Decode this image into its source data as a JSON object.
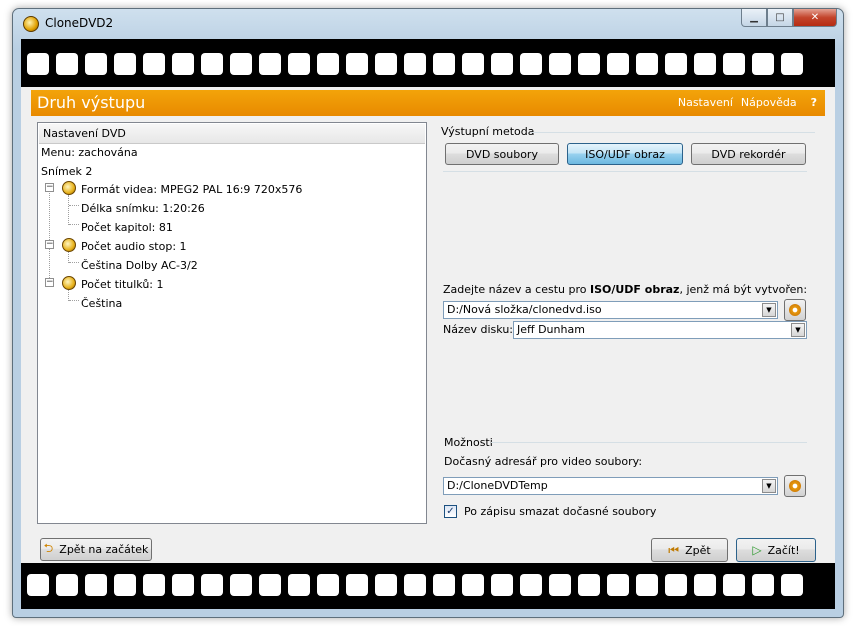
{
  "window": {
    "title": "CloneDVD2"
  },
  "header": {
    "title": "Druh výstupu",
    "links": {
      "settings": "Nastavení",
      "help": "Nápověda",
      "question": "?"
    }
  },
  "tree": {
    "header": "Nastavení DVD",
    "menu": "Menu: zachována",
    "title": "Snímek 2",
    "video": {
      "label": "Formát videa: MPEG2 PAL 16:9 720x576",
      "length": "Délka snímku: 1:20:26",
      "chapters": "Počet kapitol: 81"
    },
    "audio": {
      "label": "Počet audio stop: 1",
      "track1": "Čeština Dolby AC-3/2"
    },
    "subtitles": {
      "label": "Počet titulků: 1",
      "track1": "Čeština"
    }
  },
  "output": {
    "group_label": "Výstupní metoda",
    "buttons": {
      "dvd_files": "DVD soubory",
      "iso_udf": "ISO/UDF obraz",
      "dvd_recorder": "DVD rekordér"
    },
    "prompt_prefix": "Zadejte název a cestu pro ",
    "prompt_bold": "ISO/UDF obraz",
    "prompt_suffix": ", jenž má být vytvořen:",
    "path_value": "D:/Nová složka/clonedvd.iso",
    "disc_name_label": "Název disku:",
    "disc_name_value": "Jeff Dunham"
  },
  "options": {
    "group_label": "Možnosti",
    "temp_dir_label": "Dočasný adresář pro video soubory:",
    "temp_dir_value": "D:/CloneDVDTemp",
    "delete_temp_label": "Po zápisu smazat dočasné soubory",
    "delete_temp_checked": true
  },
  "footer": {
    "back_to_start": "Zpět na začátek",
    "back": "Zpět",
    "start": "Začít!"
  }
}
